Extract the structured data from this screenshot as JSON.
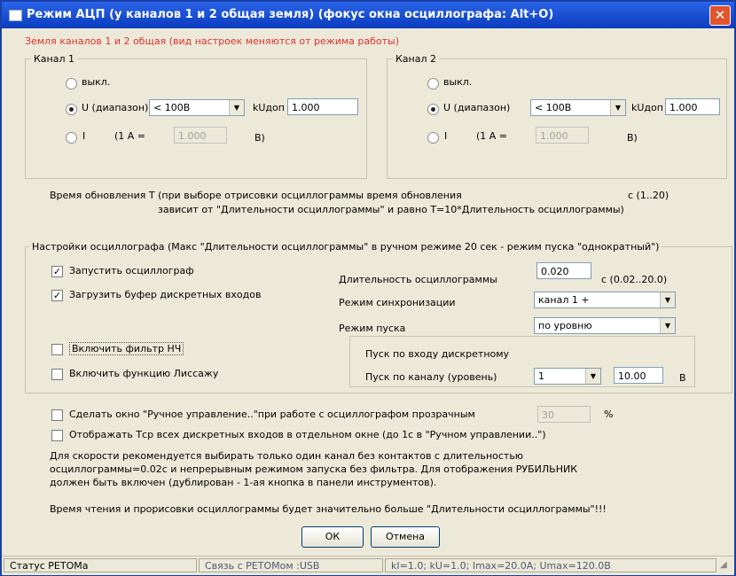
{
  "window": {
    "title": "Режим АЦП (у каналов 1 и 2 общая земля)  (фокус окна осциллографа:   Alt+O)",
    "close_glyph": "✕"
  },
  "header_note": "Земля каналов 1 и 2 общая (вид настроек меняются от режима работы)",
  "channel1": {
    "legend": "Канал 1",
    "off_label": "выкл.",
    "u_label": "U (диапазон)",
    "u_range": "< 100В",
    "k_label": "kUдоп",
    "k_value": "1.000",
    "i_label": "I",
    "i_eq_label": "(1 А =",
    "i_value": "1.000",
    "i_unit": "В)",
    "selected": "U"
  },
  "channel2": {
    "legend": "Канал 2",
    "off_label": "выкл.",
    "u_label": "U (диапазон)",
    "u_range": "< 100В",
    "k_label": "kUдоп",
    "k_value": "1.000",
    "i_label": "I",
    "i_eq_label": "(1 А =",
    "i_value": "1.000",
    "i_unit": "В)",
    "selected": "U"
  },
  "update": {
    "line1": "Время обновления Т (при выборе отрисовки осциллограммы время обновления",
    "unit_range": "с  (1..20)",
    "line2": "зависит от \"Длительности осциллограммы\" и равно Т=10*Длительность осциллограммы)"
  },
  "osc": {
    "legend": "Настройки осциллографа (Макс \"Длительности осциллограммы\" в ручном режиме 20 сек - режим пуска \"однократный\")",
    "start_osc": "Запустить осциллограф",
    "load_buffer": "Загрузить буфер дискретных входов",
    "lpf": "Включить фильтр НЧ",
    "lissajous": "Включить функцию Лиссажу",
    "duration_label": "Длительность осциллограммы",
    "duration_value": "0.020",
    "duration_unit": "с  (0.02..20.0)",
    "sync_label": "Режим синхронизации",
    "sync_value": "канал 1 +",
    "trigger_label": "Режим пуска",
    "trigger_value": "по уровню",
    "trigger_discrete": "Пуск по входу дискретному",
    "trigger_channel": "Пуск по каналу (уровень)",
    "trigger_channel_value": "1",
    "level_value": "10.00",
    "level_unit": "В"
  },
  "options": {
    "transparent_label": "Сделать окно \"Ручное управление..\"при работе с осциллографом прозрачным",
    "transparent_value": "30",
    "transparent_unit": "%",
    "tcp_label": "Отображать Тср всех дискретных входов в отдельном окне (до 1с в \"Ручном управлении..\")"
  },
  "recommendation": {
    "line1": "Для скорости рекомендуется выбирать только один канал без контактов с длительностью",
    "line2": "осциллограммы=0.02с и непрерывным режимом запуска без фильтра. Для отображения РУБИЛЬНИК",
    "line3": "должен быть включен (дублирован - 1-ая кнопка в панели инструментов)."
  },
  "warning": "Время чтения и прорисовки осциллограммы будет значительно больше \"Длительности осциллограммы\"!!!",
  "buttons": {
    "ok": "ОК",
    "cancel": "Отмена"
  },
  "status": {
    "p1": "Статус РЕТОМа",
    "p2": "Связь с РЕТОМом :USB",
    "p3": "kI=1.0; kU=1.0; Imax=20.0А; Umax=120.0В"
  }
}
